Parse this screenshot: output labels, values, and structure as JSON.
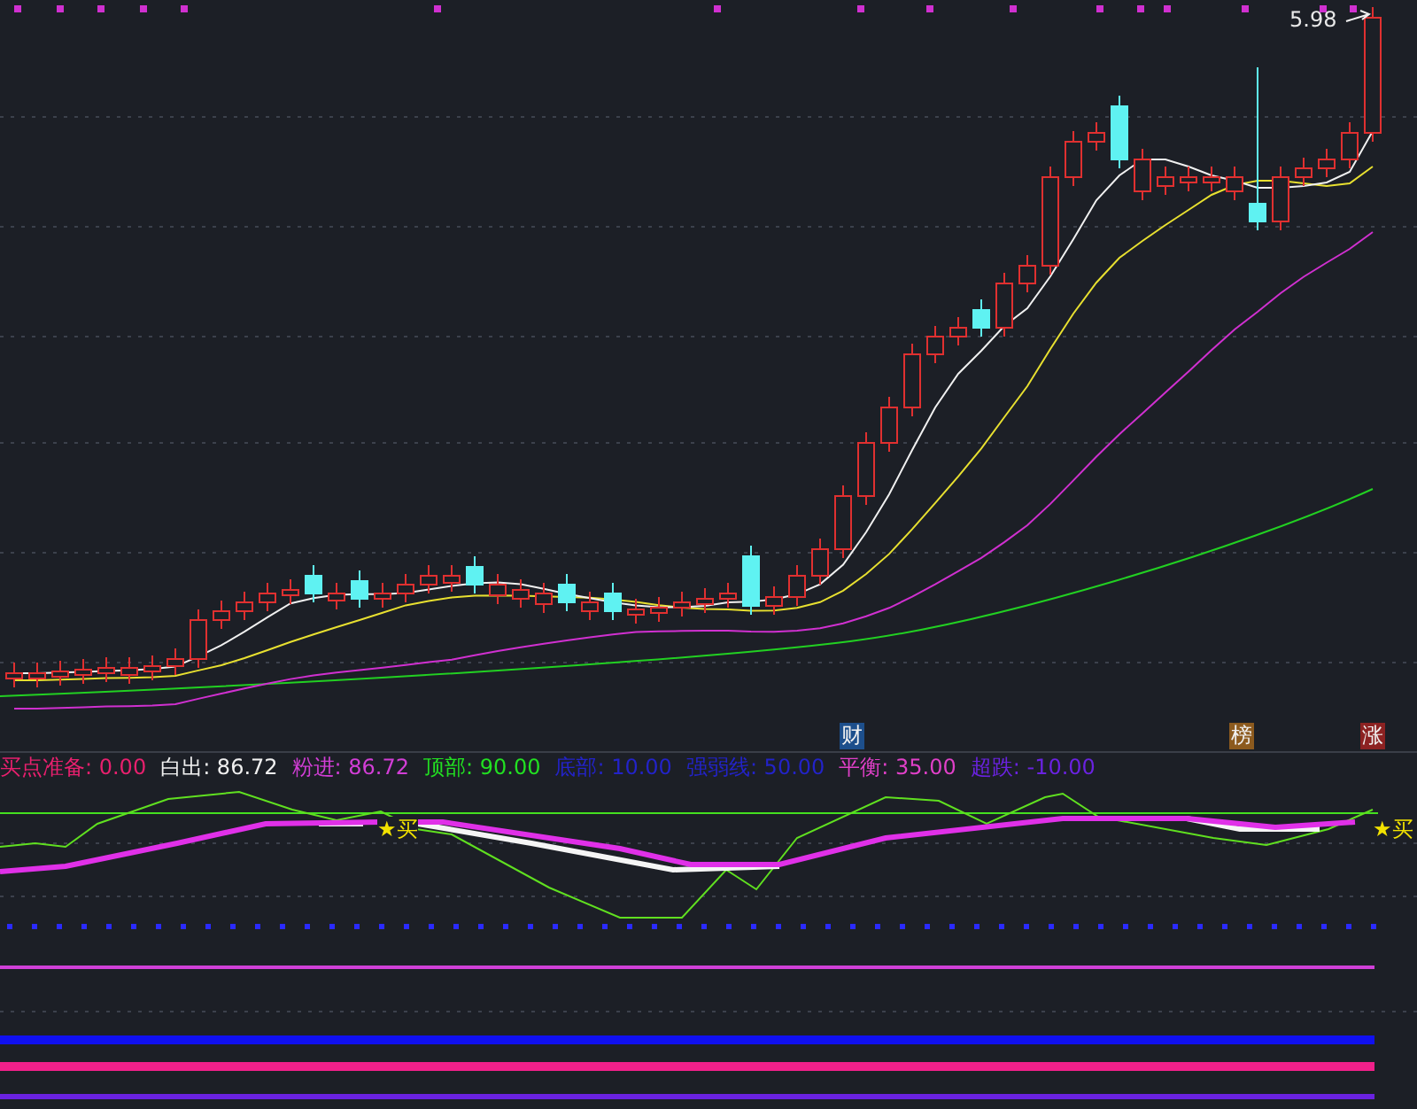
{
  "price_chart": {
    "high_label": "5.98",
    "events": [
      {
        "label": "财",
        "color": "#1d4f8c"
      },
      {
        "label": "榜",
        "color": "#8c5a1e"
      },
      {
        "label": "涨",
        "color": "#8c2222"
      }
    ]
  },
  "indicator": {
    "legend": [
      {
        "text": "买点准备: 0.00",
        "color": "#e8206e"
      },
      {
        "text": "白出: 86.72",
        "color": "#f0f0f0"
      },
      {
        "text": "粉进: 86.72",
        "color": "#d23ed6"
      },
      {
        "text": "顶部: 90.00",
        "color": "#22e022"
      },
      {
        "text": "底部: 10.00",
        "color": "#2323c8"
      },
      {
        "text": "强弱线: 50.00",
        "color": "#2323c8"
      },
      {
        "text": "平衡: 35.00",
        "color": "#e040c8"
      },
      {
        "text": "超跌: -10.00",
        "color": "#6a22e0"
      }
    ],
    "signals": [
      {
        "label": "★买"
      },
      {
        "label": "★买"
      }
    ]
  }
}
